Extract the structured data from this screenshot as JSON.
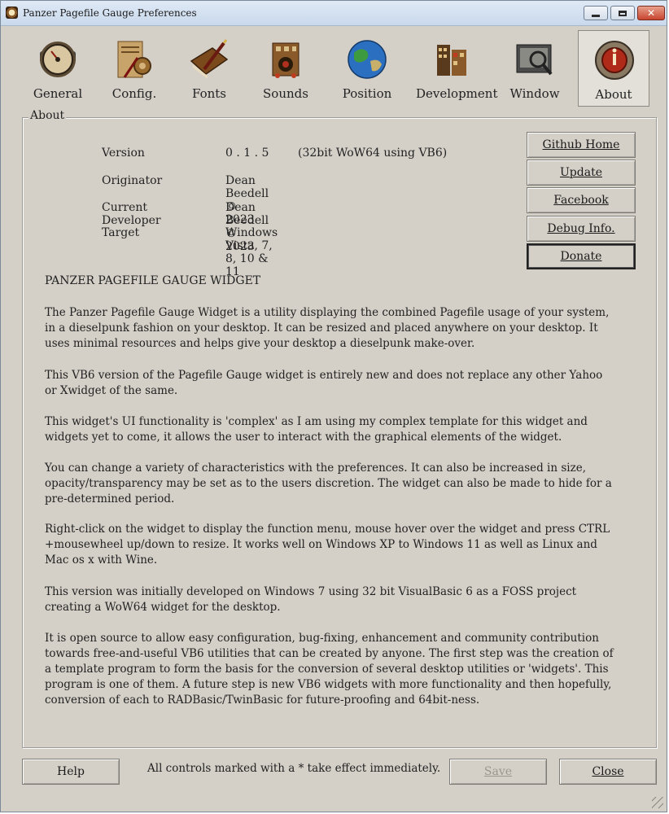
{
  "window": {
    "title": "Panzer Pagefile Gauge Preferences"
  },
  "toolbar": {
    "items": [
      {
        "label": "General",
        "icon": "gauge-icon"
      },
      {
        "label": "Config.",
        "icon": "tools-icon"
      },
      {
        "label": "Fonts",
        "icon": "book-pen-icon"
      },
      {
        "label": "Sounds",
        "icon": "speaker-icon"
      },
      {
        "label": "Position",
        "icon": "globe-icon"
      },
      {
        "label": "Development",
        "icon": "machinery-icon"
      },
      {
        "label": "Window",
        "icon": "window-icon"
      },
      {
        "label": "About",
        "icon": "about-badge-icon"
      }
    ],
    "active": "About"
  },
  "about": {
    "legend": "About",
    "rows": [
      {
        "key": "Version",
        "value": "0 . 1 . 5        (32bit WoW64 using VB6)"
      },
      {
        "key": "Originator",
        "value": "Dean Beedell © 2023"
      },
      {
        "key": "Current Developer",
        "value": "Dean Beedell © 2023"
      },
      {
        "key": "Target",
        "value": "Windows Vista, 7, 8, 10  & 11"
      }
    ],
    "buttons": [
      "Github Home",
      "Update",
      "Facebook",
      "Debug Info.",
      "Donate"
    ],
    "heading": "PANZER PAGEFILE GAUGE WIDGET",
    "paragraphs": [
      "The Panzer Pagefile Gauge Widget is a utility displaying the combined Pagefile usage of your system, in a dieselpunk fashion on your desktop. It can be resized and placed anywhere on your desktop. It uses minimal resources and helps give your desktop a dieselpunk make-over.",
      "This VB6 version of the Pagefile Gauge widget is entirely new and does not replace any other Yahoo or Xwidget of the same.",
      "This widget's UI functionality is 'complex' as I am using my complex template for this widget and widgets yet to come, it allows the user to interact with the graphical elements of the widget.",
      "You can change a variety of characteristics with the preferences. It can also be increased in size, opacity/transparency may be set as to the users discretion. The widget can also be made to hide for a pre-determined period.",
      "Right-click on the widget to display the function menu, mouse hover over the widget and press CTRL +mousewheel up/down to resize. It works well on Windows XP to Windows 11 as well as Linux and Mac os x with Wine.",
      "This version was initially developed on Windows 7 using 32 bit VisualBasic 6 as a FOSS project creating a WoW64 widget for the desktop.",
      "It is open source to allow easy configuration, bug-fixing, enhancement and community contribution towards free-and-useful VB6 utilities that can be created by anyone. The first step was the creation of a template program to form the basis for the conversion of several desktop utilities or 'widgets'. This program is one of them. A future step is new VB6 widgets with more functionality and then hopefully, conversion of each to RADBasic/TwinBasic for future-proofing and 64bit-ness."
    ]
  },
  "footer": {
    "help": "Help",
    "hint": "All controls marked with a * take effect immediately.",
    "save": "Save",
    "close": "Close"
  }
}
